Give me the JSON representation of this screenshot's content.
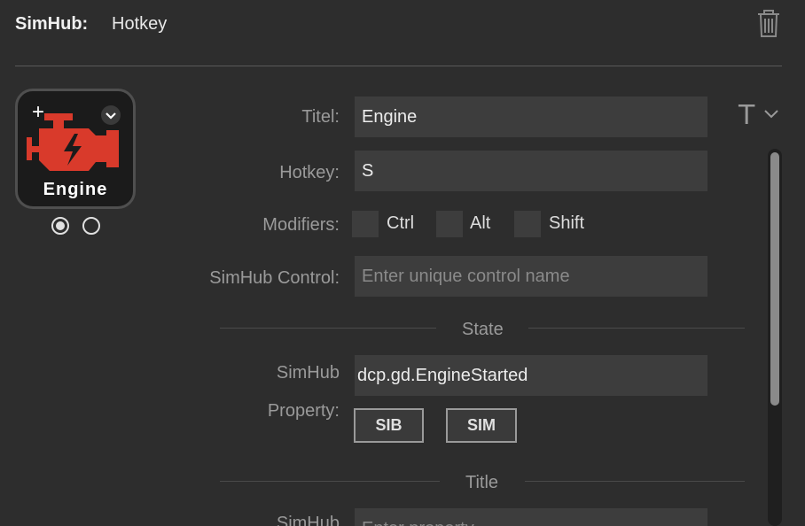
{
  "header": {
    "app_name": "SimHub:",
    "action_name": "Hotkey",
    "delete_icon": "trash-icon"
  },
  "key_preview": {
    "title": "Engine",
    "icon": "engine-check-icon",
    "icon_color": "#d93a2b",
    "add_icon": "plus-icon",
    "menu_icon": "chevron-down-icon",
    "states": [
      {
        "selected": true
      },
      {
        "selected": false
      }
    ]
  },
  "form": {
    "title_label": "Titel:",
    "title_value": "Engine",
    "hotkey_label": "Hotkey:",
    "hotkey_value": "S",
    "modifiers_label": "Modifiers:",
    "modifiers": [
      {
        "label": "Ctrl",
        "checked": false
      },
      {
        "label": "Alt",
        "checked": false
      },
      {
        "label": "Shift",
        "checked": false
      }
    ],
    "control_label": "SimHub Control:",
    "control_placeholder": "Enter unique control name",
    "font_icon": "text-format-icon"
  },
  "state_section": {
    "title": "State",
    "property_label_line1": "SimHub",
    "property_label_line2": "Property:",
    "property_value": "dcp.gd.EngineStarted",
    "buttons": [
      "SIB",
      "SIM"
    ]
  },
  "title_section": {
    "title": "Title",
    "property_label_line1": "SimHub",
    "property_placeholder": "Enter property"
  }
}
